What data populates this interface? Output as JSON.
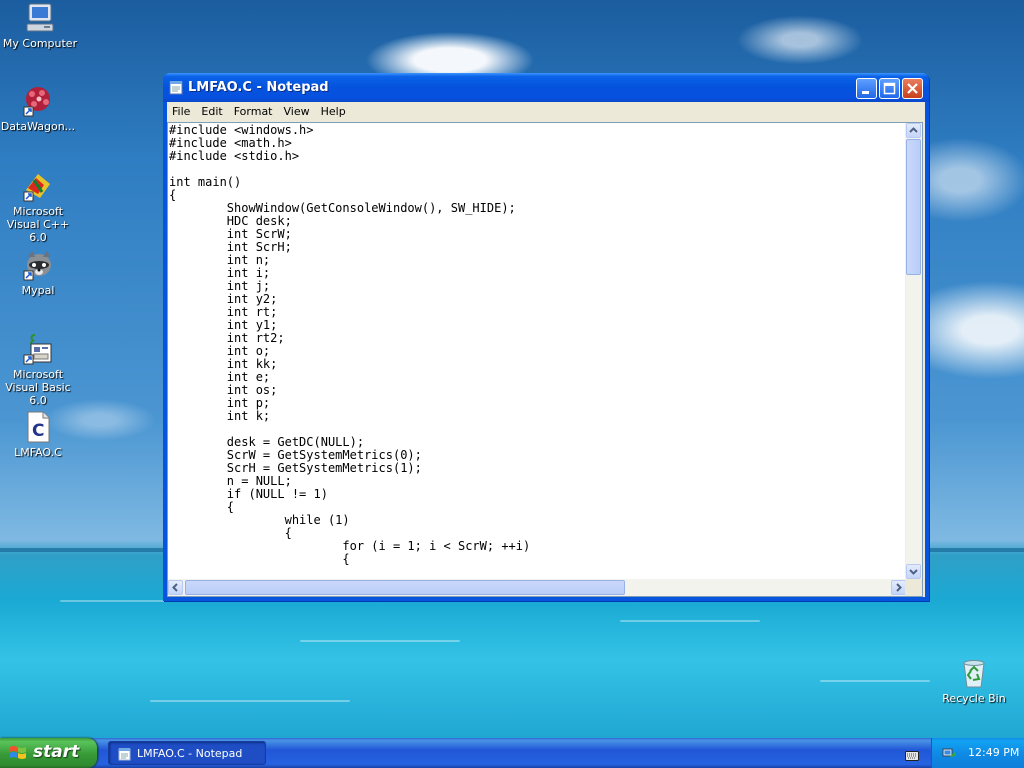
{
  "desktop": {
    "icons": [
      {
        "label": "My Computer",
        "icon": "computer-icon"
      },
      {
        "label": "DataWagon...",
        "icon": "datawagon-icon"
      },
      {
        "label": "Microsoft Visual C++ 6.0",
        "icon": "visual-cpp-icon"
      },
      {
        "label": "Mypal",
        "icon": "mypal-icon"
      },
      {
        "label": "Microsoft Visual Basic 6.0",
        "icon": "visual-basic-icon"
      },
      {
        "label": "LMFAO.C",
        "icon": "c-file-icon"
      },
      {
        "label": "Recycle Bin",
        "icon": "recycle-bin-icon"
      }
    ]
  },
  "window": {
    "title": "LMFAO.C - Notepad",
    "menu": [
      "File",
      "Edit",
      "Format",
      "View",
      "Help"
    ],
    "code_lines": [
      "#include <windows.h>",
      "#include <math.h>",
      "#include <stdio.h>",
      "",
      "int main()",
      "{",
      "        ShowWindow(GetConsoleWindow(), SW_HIDE);",
      "        HDC desk;",
      "        int ScrW;",
      "        int ScrH;",
      "        int n;",
      "        int i;",
      "        int j;",
      "        int y2;",
      "        int rt;",
      "        int y1;",
      "        int rt2;",
      "        int o;",
      "        int kk;",
      "        int e;",
      "        int os;",
      "        int p;",
      "        int k;",
      "",
      "        desk = GetDC(NULL);",
      "        ScrW = GetSystemMetrics(0);",
      "        ScrH = GetSystemMetrics(1);",
      "        n = NULL;",
      "        if (NULL != 1)",
      "        {",
      "                while (1)",
      "                {",
      "                        for (i = 1; i < ScrW; ++i)",
      "                        {"
    ]
  },
  "taskbar": {
    "start_label": "start",
    "task_label": "LMFAO.C - Notepad",
    "clock": "12:49 PM"
  },
  "colors": {
    "titlebar": "#0553dd",
    "start_button": "#379a37",
    "taskbar": "#2157d7",
    "tray": "#0f8be6"
  }
}
